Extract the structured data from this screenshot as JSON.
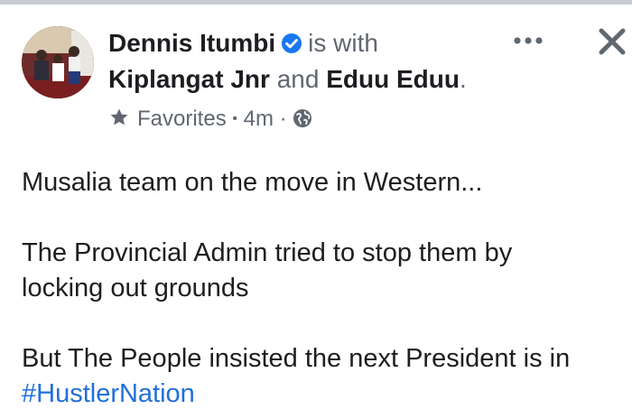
{
  "post": {
    "author": "Dennis Itumbi",
    "is_with_text": "is with",
    "tagged_1": "Kiplangat Jnr",
    "and_text": "and",
    "tagged_2": "Eduu Eduu",
    "period": ".",
    "audience": "Favorites",
    "dot": "•",
    "time": "4m",
    "dot2": "·",
    "lines": {
      "l1": "Musalia team on the move in Western...",
      "l2": "The Provincial Admin tried to stop them by",
      "l3": "locking out grounds",
      "l4": "But The People insisted the next President is in",
      "hashtag": "#HustlerNation"
    }
  },
  "icons": {
    "verified": "verified-badge-icon",
    "star": "star-icon",
    "globe": "globe-icon",
    "more": "more-options-icon",
    "close": "close-icon"
  },
  "colors": {
    "verified_blue": "#1877f2",
    "hashtag": "#216fdb",
    "muted": "#606770",
    "text": "#1c1e21"
  }
}
